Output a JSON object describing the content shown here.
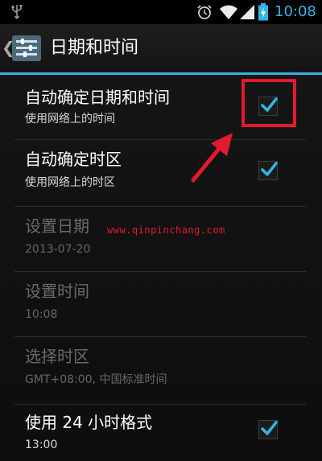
{
  "status_bar": {
    "time": "10:08",
    "icons": [
      "usb-icon",
      "alarm-icon",
      "wifi-icon",
      "signal-icon",
      "battery-icon"
    ],
    "time_color": "#33b5e5"
  },
  "action_bar": {
    "title": "日期和时间",
    "icon": "settings-icon",
    "accent": "#33b5e5"
  },
  "settings": [
    {
      "id": "auto-datetime",
      "title": "自动确定日期和时间",
      "summary": "使用网络上的时间",
      "checked": true,
      "enabled": true
    },
    {
      "id": "auto-timezone",
      "title": "自动确定时区",
      "summary": "使用网络上的时区",
      "checked": true,
      "enabled": true
    },
    {
      "id": "set-date",
      "title": "设置日期",
      "summary": "2013-07-20",
      "enabled": false
    },
    {
      "id": "set-time",
      "title": "设置时间",
      "summary": "10:08",
      "enabled": false
    },
    {
      "id": "select-timezone",
      "title": "选择时区",
      "summary": "GMT+08:00, 中国标准时间",
      "enabled": false
    },
    {
      "id": "use-24-hour",
      "title": "使用 24 小时格式",
      "summary": "13:00",
      "checked": true,
      "enabled": true
    }
  ],
  "watermark": "www.qinpinchang.com",
  "annotation_color": "#e3192d"
}
